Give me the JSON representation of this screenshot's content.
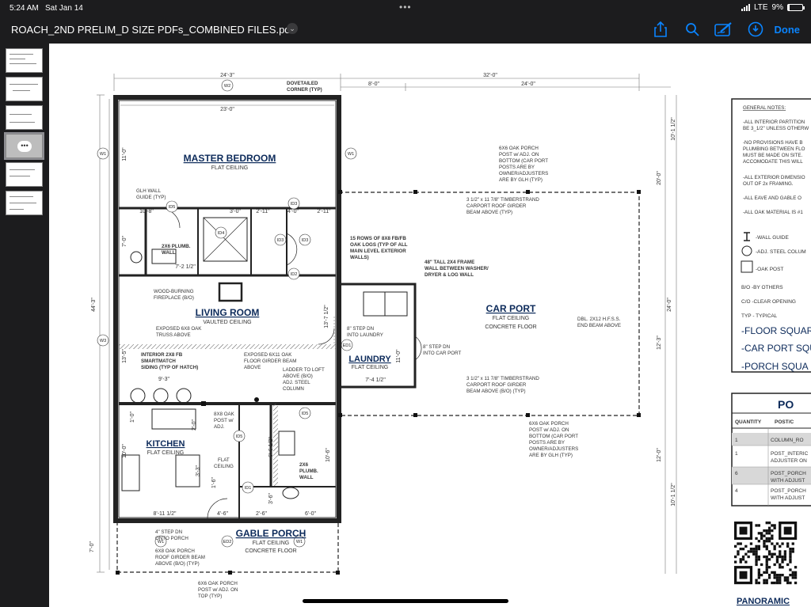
{
  "status_bar": {
    "time": "5:24 AM",
    "date": "Sat Jan 14",
    "network": "LTE",
    "battery": "9%",
    "battery_level": 0.09
  },
  "toolbar": {
    "title": "ROACH_2ND PRELIM_D SIZE PDFs_COMBINED FILES.pdf",
    "done_label": "Done"
  },
  "plan": {
    "dim_top_left": "24'-3\"",
    "dim_top_total": "32'-0\"",
    "dim_top_carport_a": "8'-0\"",
    "dim_top_carport_b": "24'-0\"",
    "dim_inner_top": "23'-0\"",
    "dim_left_total": "44'-3\"",
    "dim_left_a": "11'-0\"",
    "dim_left_b": "7'-0\"",
    "dim_left_c": "13'-5\"",
    "dim_left_d": "1'-0\"",
    "dim_left_e": "10'-0\"",
    "dim_left_f": "7'-0\"",
    "dim_right_a": "10'-1 1/2\"",
    "dim_right_b": "20'-0\"",
    "dim_right_c": "24'-0\"",
    "dim_right_d": "12'-3\"",
    "dim_right_e": "12'-0\"",
    "dim_right_f": "10'-1 1/2\"",
    "dim_mid_v": "13'-7 1/2\"",
    "dim_laundry_w": "7'-4 1/2\"",
    "dim_laundry_h": "11'-0\"",
    "dim_10_8": "10'-8\"",
    "dim_3_0": "3'-0\"",
    "dim_2_11a": "2'-11\"",
    "dim_4_0": "4'-0\"",
    "dim_2_11b": "2'-11\"",
    "dim_7_2": "7'-2 1/2\"",
    "dim_9_3": "9'-3\"",
    "dim_2_0": "2'-0\"",
    "dim_8_11": "8'-11 1/2\"",
    "dim_4_6": "4'-6\"",
    "dim_2_6": "2'-6\"",
    "dim_6_0": "6'-0\"",
    "dim_10_6": "10'-6\"",
    "dim_6_6": "6'-6 1/2\"",
    "dim_3_3": "3'-3\"",
    "dim_3_6": "3'-6\"",
    "dim_1_6": "1'-6\"",
    "rooms": {
      "master": "MASTER BEDROOM",
      "master_ceiling": "FLAT CEILING",
      "living": "LIVING ROOM",
      "living_ceiling": "VAULTED CEILING",
      "kitchen": "KITCHEN",
      "kitchen_ceiling": "FLAT CEILING",
      "laundry": "LAUNDRY",
      "laundry_ceiling": "FLAT CEILING",
      "carport": "CAR PORT",
      "carport_ceiling": "FLAT CEILING",
      "carport_floor": "CONCRETE FLOOR",
      "porch": "GABLE PORCH",
      "porch_ceiling": "FLAT CEILING",
      "porch_floor": "CONCRETE FLOOR"
    },
    "tags": {
      "w2": "W2",
      "w1a": "W1",
      "w1b": "W1",
      "w1c": "W1",
      "w1d": "W1",
      "w3": "W3",
      "id5a": "ID5",
      "id4": "ID4",
      "id3a": "ID3",
      "id3b": "ID3",
      "id3c": "ID3",
      "id2": "ID2",
      "id1": "ID1",
      "ed1": "ED1",
      "id5b": "ID5",
      "ed2": "ED2",
      "id5c": "ID5"
    },
    "notes": {
      "dovetailed_1": "DOVETAILED",
      "dovetailed_2": "CORNER (TYP)",
      "glh_1": "GLH WALL",
      "glh_2": "GUIDE (TYP)",
      "plumb_1": "2X6 PLUMB.",
      "plumb_2": "WALL",
      "fire_1": "WOOD-BURNING",
      "fire_2": "FIREPLACE (B/O)",
      "truss_1": "EXPOSED 6X8 OAK",
      "truss_2": "TRUSS ABOVE",
      "siding_1": "INTERIOR 2X8 FB",
      "siding_2": "SMARTMATCH",
      "siding_3": "SIDING (TYP OF HATCH)",
      "girder_1": "EXPOSED 6X11 OAK",
      "girder_2": "FLOOR GIRDER BEAM",
      "girder_3": "ABOVE",
      "ladder_1": "LADDER TO LOFT",
      "ladder_2": "ABOVE (B/O)",
      "ladder_3": "ADJ. STEEL",
      "ladder_4": "COLUMN",
      "post8_1": "8X8 OAK",
      "post8_2": "POST w/",
      "post8_3": "ADJ.",
      "flat_1": "FLAT",
      "flat_2": "CEILING",
      "plumb2_1": "2X6",
      "plumb2_2": "PLUMB.",
      "plumb2_3": "WALL",
      "logs_1": "15 ROWS OF 8X8 FB/FB",
      "logs_2": "OAK LOGS (TYP OF ALL",
      "logs_3": "MAIN LEVEL EXTERIOR",
      "logs_4": "WALLS)",
      "frame_1": "48\" TALL 2X4 FRAME",
      "frame_2": "WALL BETWEEN WASHER/",
      "frame_3": "DRYER & LOG WALL",
      "step_l_1": "8\" STEP DN",
      "step_l_2": "INTO LAUNDRY",
      "step_c_1": "8\" STEP DN",
      "step_c_2": "INTO CAR PORT",
      "postA_1": "6X6 OAK PORCH",
      "postA_2": "POST w/ ADJ. ON",
      "postA_3": "BOTTOM (CAR PORT",
      "postA_4": "POSTS ARE BY",
      "postA_5": "OWNER/ADJUSTERS",
      "postA_6": "ARE BY GLH (TYP)",
      "beamA_1": "3 1/2\" x 11 7/8\" TIMBERSTRAND",
      "beamA_2": "CARPORT ROOF GIRDER",
      "beamA_3": "BEAM ABOVE (TYP)",
      "endbeam_1": "DBL. 2X12 H.F.S.S.",
      "endbeam_2": "END BEAM ABOVE",
      "beamB_1": "3 1/2\" x 11 7/8\" TIMBERSTRAND",
      "beamB_2": "CARPORT ROOF GIRDER",
      "beamB_3": "BEAM ABOVE (B/O) (TYP)",
      "postB_1": "6X6 OAK PORCH",
      "postB_2": "POST w/ ADJ. ON",
      "postB_3": "BOTTOM (CAR PORT",
      "postB_4": "POSTS ARE BY",
      "postB_5": "OWNER/ADJUSTERS",
      "postB_6": "ARE BY GLH (TYP)",
      "pstep_1": "4\" STEP DN",
      "pstep_2": "ONTO PORCH",
      "pbeam_1": "6X8 OAK PORCH",
      "pbeam_2": "ROOF GIRDER BEAM",
      "pbeam_3": "ABOVE (B/O) (TYP)",
      "ppost_1": "6X6 OAK PORCH",
      "ppost_2": "POST w/ ADJ. ON",
      "ppost_3": "TOP (TYP)"
    }
  },
  "general_notes": {
    "heading": "GENERAL NOTES:",
    "n1a": "-ALL INTERIOR PARTITION",
    "n1b": "BE 3_1/2\" UNLESS OTHERW",
    "n2a": "-NO PROVISIONS HAVE B",
    "n2b": "PLUMBING BETWEEN FLO",
    "n2c": "MUST BE MADE ON SITE.",
    "n2d": "ACCOMODATE THIS WILL",
    "n3a": "-ALL EXTERIOR DIMENSIO",
    "n3b": "OUT OF 2x FRAMING.",
    "n4": "-ALL EAVE AND GABLE O",
    "n5": "-ALL OAK MATERIAL IS #1"
  },
  "legend": {
    "wall_guide": "-WALL GUIDE",
    "steel_column": "-ADJ. STEEL COLUM",
    "oak_post": "-OAK POST",
    "bo": "B/O  -BY OTHERS",
    "co": "C/O  -CLEAR OPENING",
    "typ": "TYP  - TYPICAL",
    "floor_sq": "-FLOOR SQUAR",
    "carport_sq": "-CAR PORT SQU",
    "porch_sq": "-PORCH SQUA"
  },
  "post_table": {
    "title": "PO",
    "col_quantity": "QUANTITY",
    "col_post": "POST/C",
    "rows": [
      {
        "qty": "1",
        "name_a": "COLUMN_RO",
        "name_b": ""
      },
      {
        "qty": "1",
        "name_a": "POST_INTERIC",
        "name_b": "ADJUSTER ON"
      },
      {
        "qty": "6",
        "name_a": "POST_PORCH",
        "name_b": "WITH ADJUST"
      },
      {
        "qty": "4",
        "name_a": "POST_PORCH",
        "name_b": "WITH ADJUST"
      }
    ]
  },
  "panoramic": "PANORAMIC"
}
